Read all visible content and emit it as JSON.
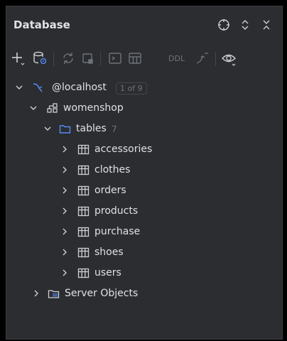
{
  "panel": {
    "title": "Database"
  },
  "toolbar": {
    "ddl_label": "DDL"
  },
  "tree": {
    "connection": {
      "label": "@localhost",
      "badge": "1 of 9"
    },
    "database": {
      "label": "womenshop"
    },
    "tables_folder": {
      "label": "tables",
      "count": "7"
    },
    "tables": [
      {
        "label": "accessories"
      },
      {
        "label": "clothes"
      },
      {
        "label": "orders"
      },
      {
        "label": "products"
      },
      {
        "label": "purchase"
      },
      {
        "label": "shoes"
      },
      {
        "label": "users"
      }
    ],
    "server_objects": {
      "label": "Server Objects"
    }
  },
  "colors": {
    "panel_bg": "#2b2d30",
    "text": "#dfe1e5",
    "muted": "#6f737a",
    "accent_blue": "#548af7"
  }
}
